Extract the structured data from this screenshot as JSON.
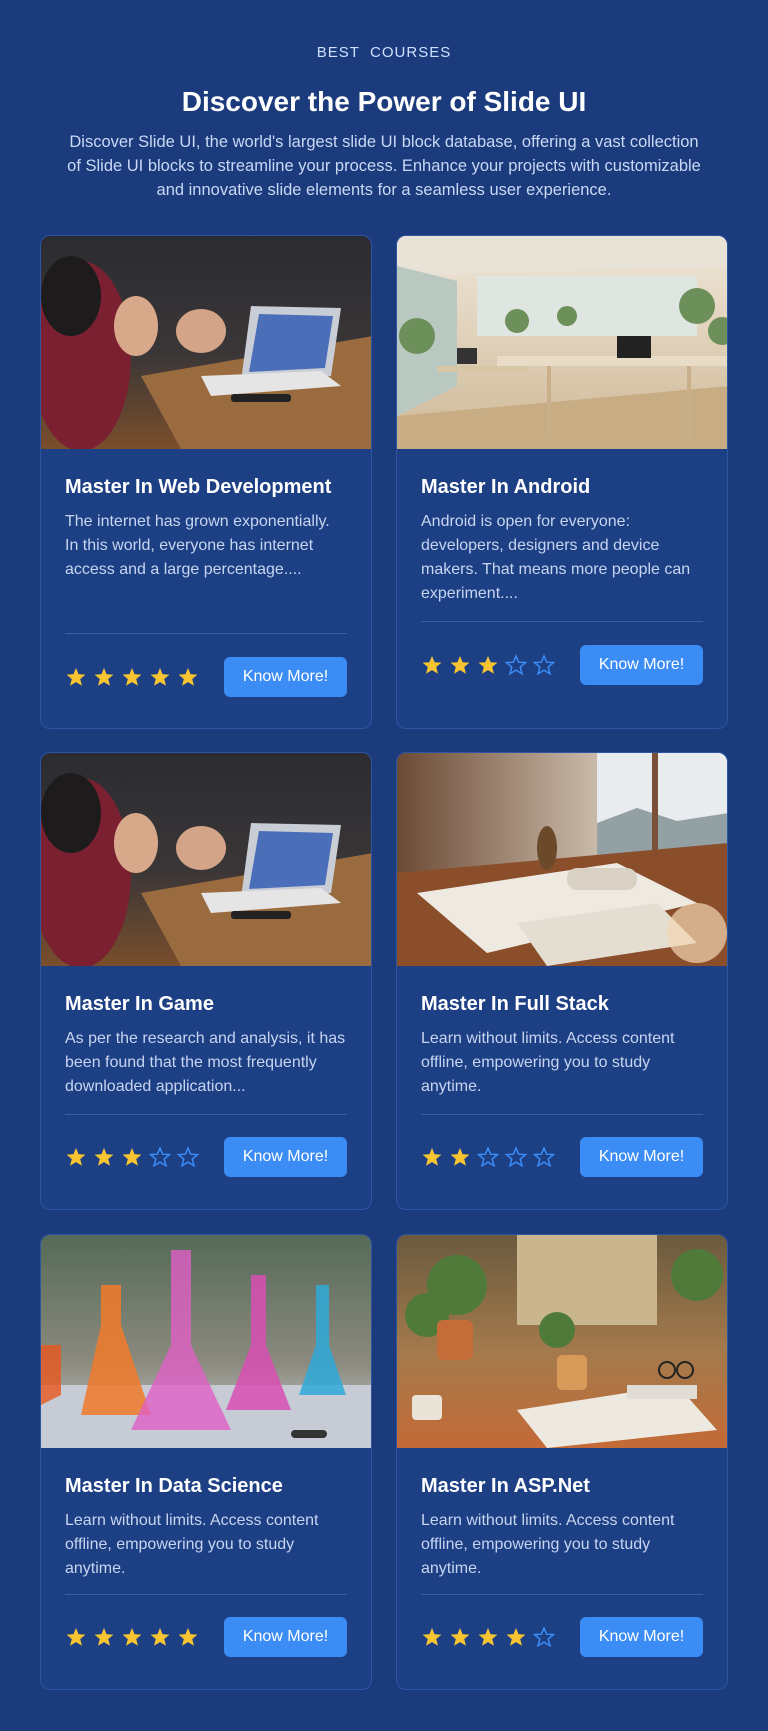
{
  "header": {
    "eyebrow": "BEST  COURSES",
    "title": "Discover the Power of Slide UI",
    "description": "Discover Slide UI, the world's largest slide UI block database, offering a vast collection of Slide UI blocks to streamline your process. Enhance your projects with customizable and innovative slide elements for a seamless user experience."
  },
  "colors": {
    "background": "#1b3b7c",
    "card": "#1d3f84",
    "button": "#3b8cf5",
    "star_filled": "#f7c531",
    "star_empty": "#3b8cf5"
  },
  "courses": [
    {
      "title": "Master In Web Development",
      "text": "The internet has grown exponentially. In this world, everyone has internet access and a large percentage....",
      "rating": 5,
      "button": "Know More!",
      "image": "hands-laptop-photo"
    },
    {
      "title": "Master In Android",
      "text": "Android is open for everyone: developers, designers and device makers. That means more people can experiment....",
      "rating": 3,
      "button": "Know More!",
      "image": "office-interior-photo"
    },
    {
      "title": "Master In Game",
      "text": "As per the research and analysis, it has been found that the most frequently downloaded application...",
      "rating": 3,
      "button": "Know More!",
      "image": "hands-laptop-photo"
    },
    {
      "title": "Master In Full Stack",
      "text": "Learn without limits. Access content offline, empowering you to study anytime.",
      "rating": 2,
      "button": "Know More!",
      "image": "desk-with-books-photo"
    },
    {
      "title": "Master In Data Science",
      "text": "Learn without limits. Access content offline, empowering you to study anytime.",
      "rating": 5,
      "button": "Know More!",
      "image": "lab-flasks-photo"
    },
    {
      "title": "Master In ASP.Net",
      "text": "Learn without limits. Access content offline, empowering you to study anytime.",
      "rating": 4,
      "button": "Know More!",
      "image": "plants-desk-photo"
    }
  ]
}
